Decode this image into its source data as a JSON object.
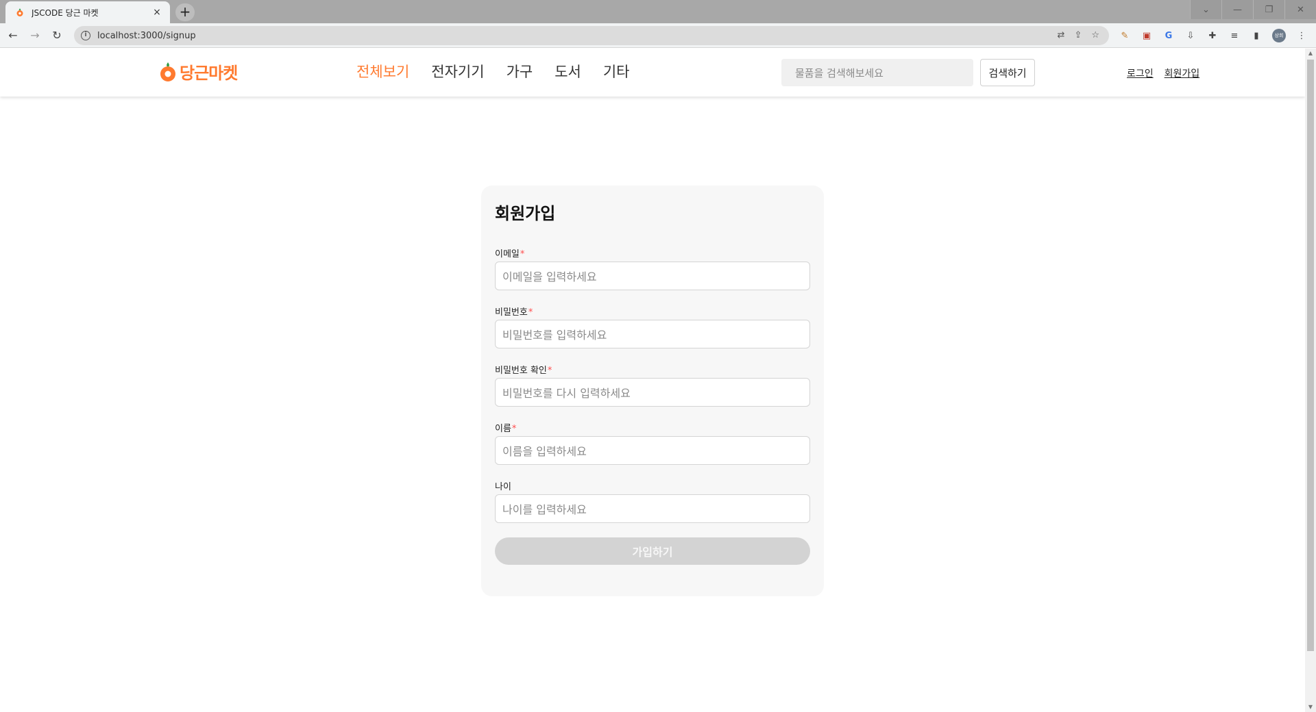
{
  "browser": {
    "tab_title": "JSCODE 당근 마켓",
    "tab_close": "×",
    "new_tab": "+",
    "url": "localhost:3000/signup",
    "back": "←",
    "forward": "→",
    "reload": "↻",
    "info": "i",
    "profile_avatar": "상희",
    "window_controls": {
      "dropdown": "⌄",
      "minimize": "—",
      "restore": "❐",
      "close": "✕"
    },
    "omnibox_actions": {
      "translate": "⇄",
      "share": "⇪",
      "bookmark": "☆"
    },
    "extensions": {
      "ext1": "✎",
      "ext2": "▣",
      "ext3": "G",
      "ext4": "⇩",
      "puzzle": "✚",
      "reading_list": "≡",
      "side_panel": "▮",
      "menu": "⋮"
    }
  },
  "header": {
    "logo_text": "당근마켓",
    "nav": [
      "전체보기",
      "전자기기",
      "가구",
      "도서",
      "기타"
    ],
    "active_nav_index": 0,
    "search_placeholder": "물품을 검색해보세요",
    "search_button": "검색하기",
    "login": "로그인",
    "signup": "회원가입"
  },
  "signup_form": {
    "title": "회원가입",
    "fields": [
      {
        "label": "이메일",
        "required_mark": "*",
        "placeholder": "이메일을 입력하세요"
      },
      {
        "label": "비밀번호",
        "required_mark": "*",
        "placeholder": "비밀번호를 입력하세요"
      },
      {
        "label": "비밀번호 확인",
        "required_mark": "*",
        "placeholder": "비밀번호를 다시 입력하세요"
      },
      {
        "label": "이름",
        "required_mark": "*",
        "placeholder": "이름을 입력하세요"
      },
      {
        "label": "나이",
        "required_mark": "",
        "placeholder": "나이를 입력하세요"
      }
    ],
    "submit_label": "가입하기",
    "submit_enabled": false
  },
  "colors": {
    "brand": "#ff7a2f",
    "required": "#ff4d4d",
    "disabled_button": "#d3d3d3",
    "card_bg": "#f7f7f7"
  }
}
